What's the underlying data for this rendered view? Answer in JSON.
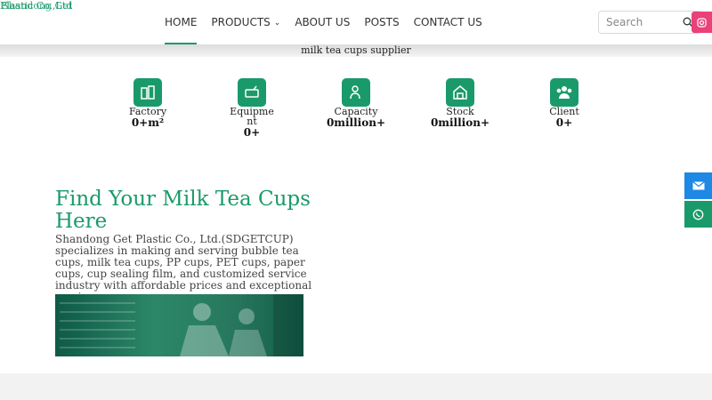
{
  "brand": {
    "logo_text_a": "Plastic Co.,Ltd",
    "logo_text_b": "Shandong Get"
  },
  "nav": {
    "items": [
      {
        "label": "HOME",
        "active": true
      },
      {
        "label": "PRODUCTS",
        "has_dropdown": true
      },
      {
        "label": "ABOUT US"
      },
      {
        "label": "POSTS"
      },
      {
        "label": "CONTACT US"
      }
    ]
  },
  "search": {
    "placeholder": "Search"
  },
  "banner": {
    "text": "milk tea cups supplier"
  },
  "stats": [
    {
      "label": "Factory",
      "value": "0+m²",
      "icon": "factory-icon"
    },
    {
      "label": "Equipment",
      "value": "0+",
      "icon": "equipment-icon"
    },
    {
      "label": "Capacity",
      "value": "0million+",
      "icon": "capacity-icon"
    },
    {
      "label": "Stock",
      "value": "0million+",
      "icon": "stock-icon"
    },
    {
      "label": "Client",
      "value": "0+",
      "icon": "client-icon"
    }
  ],
  "about": {
    "heading": "Find Your Milk Tea Cups Here",
    "body": "Shandong Get Plastic Co., Ltd.(SDGETCUP) specializes in making and serving bubble tea cups, milk tea cups, PP cups, PET cups, paper cups, cup sealing film, and customized service industry with affordable prices and exceptional service."
  },
  "colors": {
    "accent": "#1a9a6a",
    "email": "#1e88e5",
    "instagram": "#ec407a"
  }
}
